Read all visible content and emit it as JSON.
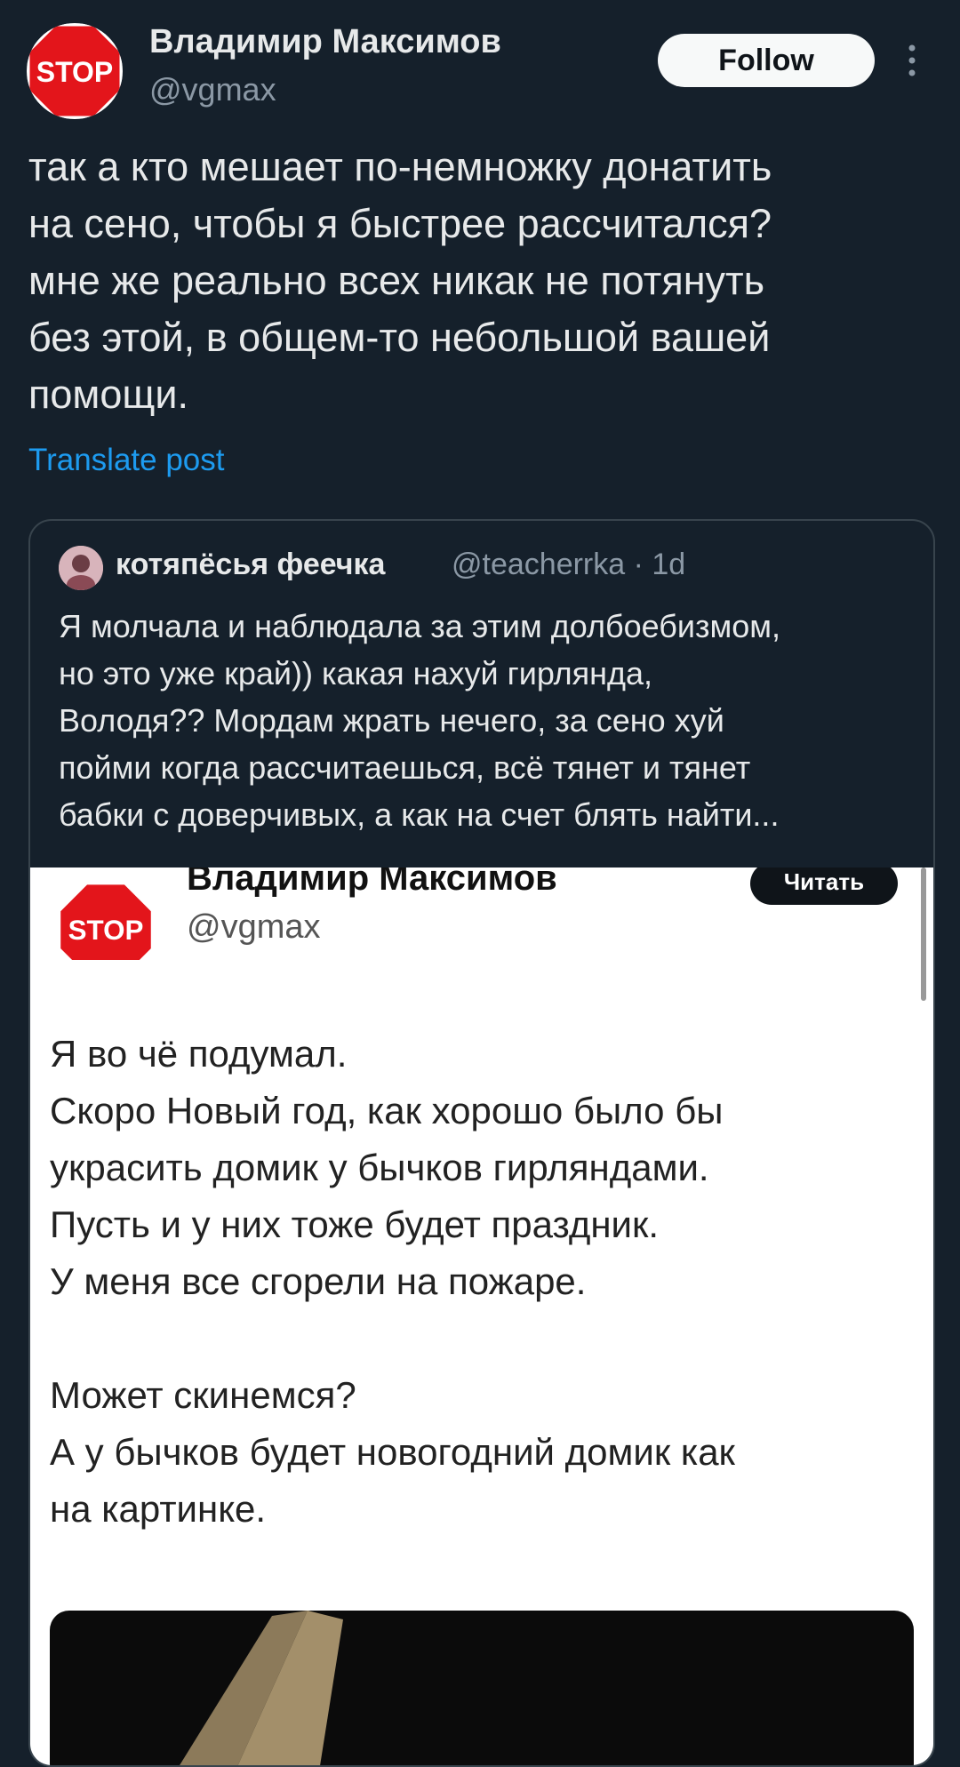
{
  "post": {
    "author_name": "Владимир Максимов",
    "author_handle": "@vgmax",
    "follow_label": "Follow",
    "avatar_text": "STOP",
    "text": "так а кто мешает по-немножку донатить\nна сено, чтобы я быстрее рассчитался?\nмне же реально всех никак не потянуть\nбез этой, в общем-то небольшой вашей\nпомощи.",
    "translate_label": "Translate post"
  },
  "quote": {
    "author_name": "котяпёсья феечка",
    "meta": "@teacherrka · 1d",
    "text": "Я молчала и наблюдала за этим долбоебизмом,\nно это уже край)) какая нахуй гирлянда,\nВолодя?? Мордам жрать нечего, за сено хуй\nпойми когда рассчитаешься, всё тянет и тянет\nбабки с доверчивых, а как на счет блять найти...",
    "image": {
      "avatar_text": "STOP",
      "author_name": "Владимир Максимов",
      "author_handle": "@vgmax",
      "button_label": "Читать",
      "text": "Я во чё подумал.\nСкоро Новый год, как хорошо было бы\nукрасить домик у бычков гирляндами.\nПусть и у них тоже будет праздник.\nУ меня все сгорели на пожаре.\n\nМожет скинемся?\nА у бычков будет новогодний домик как\nна картинке."
    }
  },
  "colors": {
    "background": "#15202b",
    "link": "#1d9bf0",
    "stop_red": "#e3151b"
  }
}
